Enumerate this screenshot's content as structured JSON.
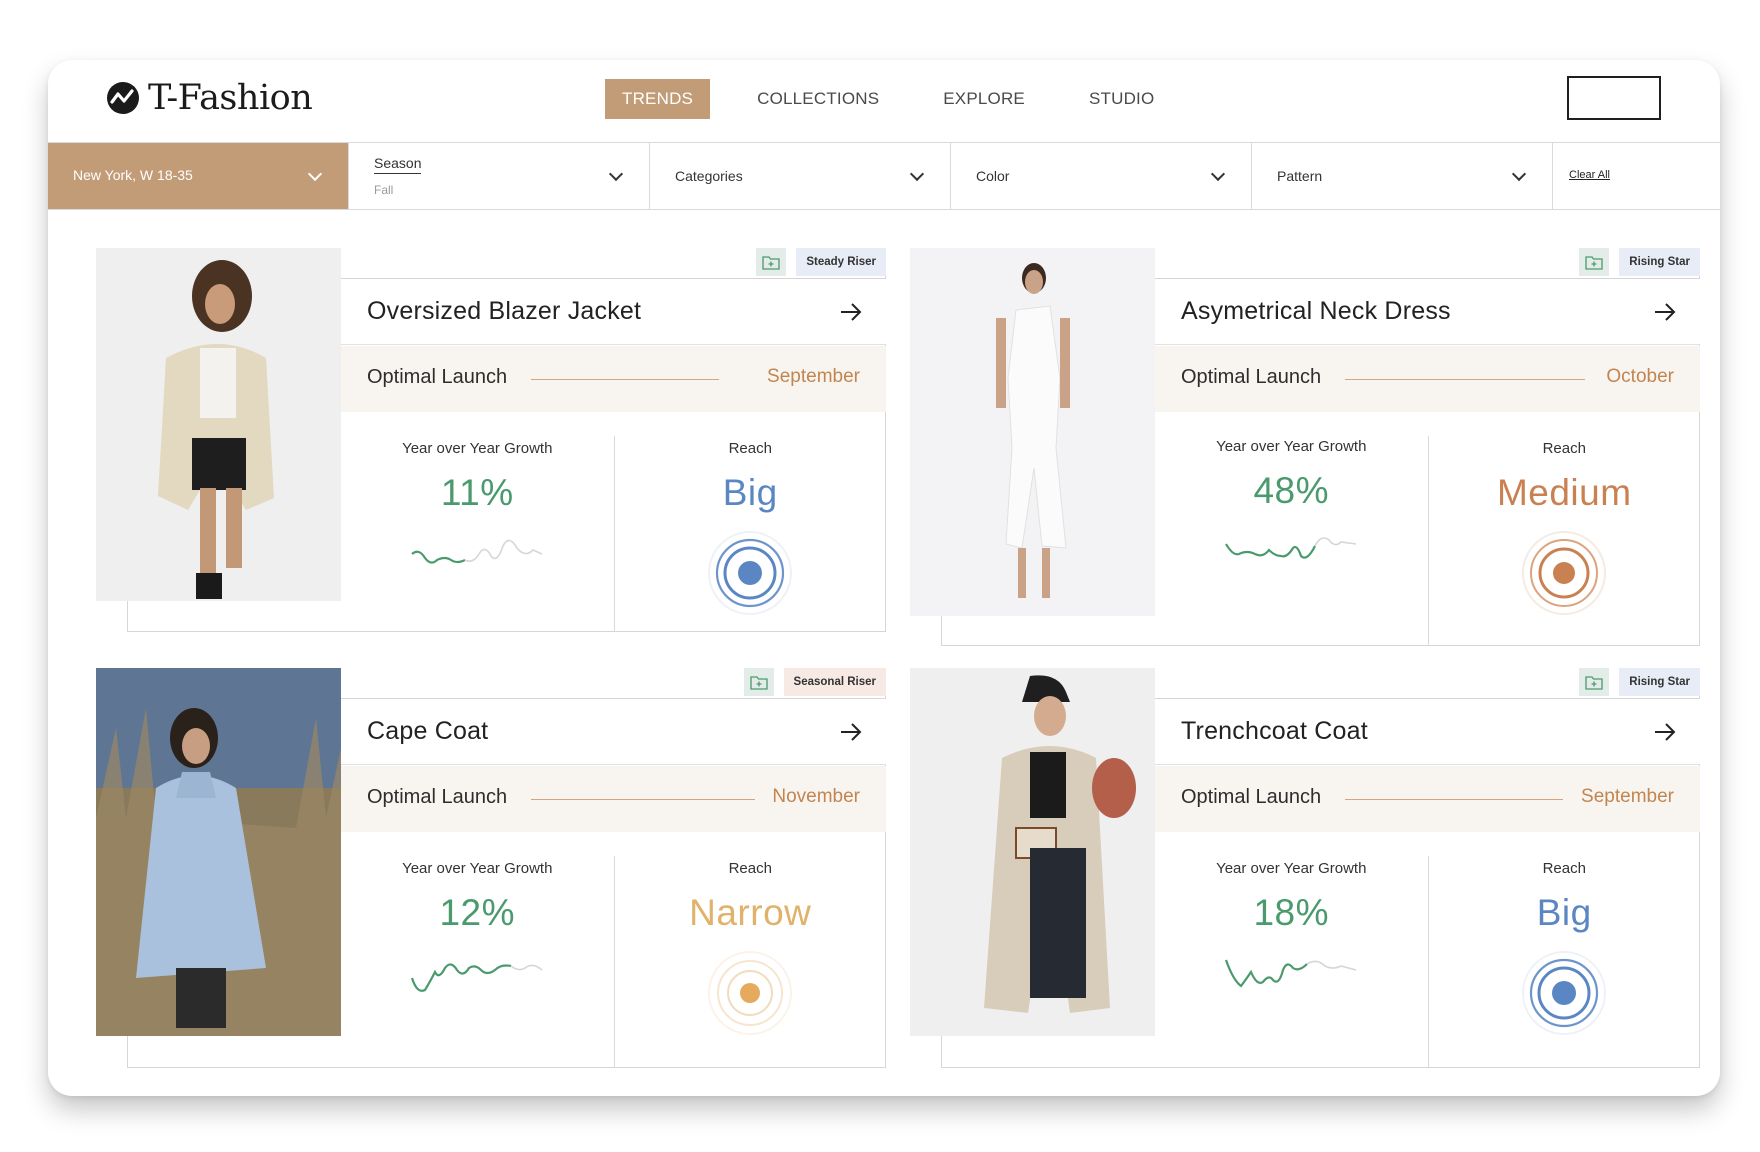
{
  "app": {
    "brand": "T-Fashion",
    "nav": [
      {
        "label": "TRENDS",
        "active": true
      },
      {
        "label": "COLLECTIONS",
        "active": false
      },
      {
        "label": "EXPLORE",
        "active": false
      },
      {
        "label": "STUDIO",
        "active": false
      }
    ]
  },
  "filters": {
    "location": "New York, W 18-35",
    "season": {
      "label": "Season",
      "value": "Fall"
    },
    "categories": "Categories",
    "color": "Color",
    "pattern": "Pattern",
    "clear_all": "Clear All"
  },
  "common": {
    "launch_label": "Optimal Launch",
    "growth_label": "Year over Year Growth",
    "reach_label": "Reach"
  },
  "cards": [
    {
      "title": "Oversized Blazer Jacket",
      "badge": "Steady Riser",
      "badge_style": "blue",
      "launch": "September",
      "growth": "11%",
      "reach": "Big",
      "reach_color": "#5a87c4"
    },
    {
      "title": "Asymetrical Neck Dress",
      "badge": "Rising Star",
      "badge_style": "blue",
      "launch": "October",
      "growth": "48%",
      "reach": "Medium",
      "reach_color": "#c98152"
    },
    {
      "title": "Cape Coat",
      "badge": "Seasonal Riser",
      "badge_style": "pink",
      "launch": "November",
      "growth": "12%",
      "reach": "Narrow",
      "reach_color": "#e0b26c"
    },
    {
      "title": "Trenchcoat Coat",
      "badge": "Rising Star",
      "badge_style": "blue",
      "launch": "September",
      "growth": "18%",
      "reach": "Big",
      "reach_color": "#5a87c4"
    }
  ],
  "colors": {
    "accent": "#c29c76",
    "growth_green": "#4a9a6d",
    "launch_orange": "#c28550"
  }
}
